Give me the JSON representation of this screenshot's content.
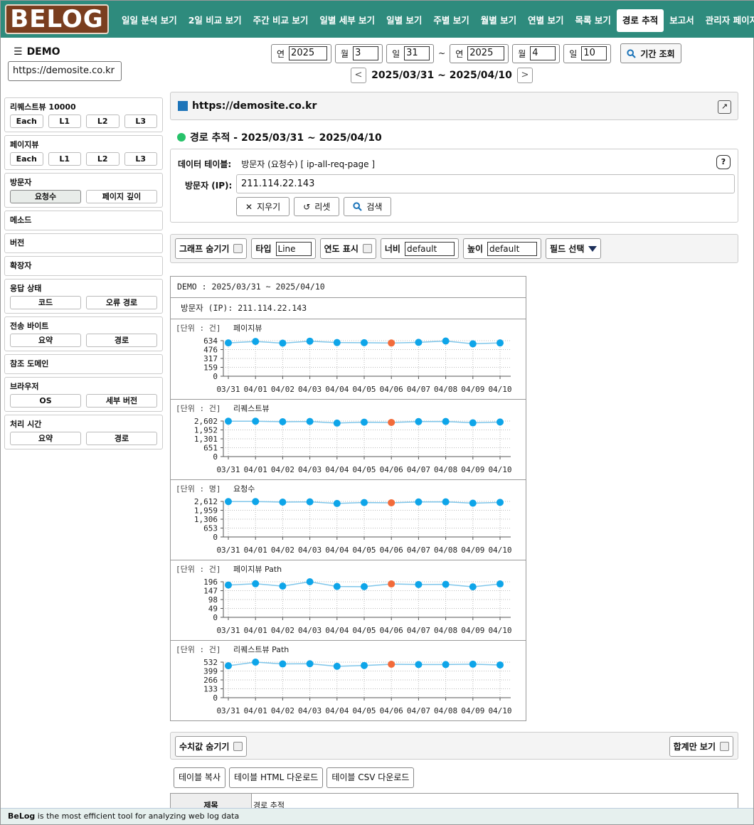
{
  "app": {
    "logo": "BELOG",
    "nav": [
      "일일 분석 보기",
      "2일 비교 보기",
      "주간 비교 보기",
      "일별 세부 보기",
      "일별 보기",
      "주별 보기",
      "월별 보기",
      "연별 보기",
      "목록 보기",
      "경로 추적",
      "보고서",
      "관리자 페이지"
    ],
    "nav_active": "경로 추적"
  },
  "site": {
    "name": "DEMO",
    "url": "https://demosite.co.kr"
  },
  "date_filter": {
    "from_year_label": "연",
    "from_year": "2025",
    "from_month_label": "월",
    "from_month": "3",
    "from_day_label": "일",
    "from_day": "31",
    "sep": "~",
    "to_year_label": "연",
    "to_year": "2025",
    "to_month_label": "월",
    "to_month": "4",
    "to_day_label": "일",
    "to_day": "10",
    "query_label": "기간 조회",
    "range_text": "2025/03/31 ~ 2025/04/10",
    "prev": "<",
    "next": ">"
  },
  "sidebar": [
    {
      "title": "리퀘스트뷰 10000",
      "buttons": [
        "Each",
        "L1",
        "L2",
        "L3"
      ]
    },
    {
      "title": "페이지뷰",
      "buttons": [
        "Each",
        "L1",
        "L2",
        "L3"
      ]
    },
    {
      "title": "방문자",
      "buttons": [
        "요청수",
        "페이지 깊이"
      ],
      "active": "요청수"
    },
    {
      "title": "메소드",
      "buttons": []
    },
    {
      "title": "버전",
      "buttons": []
    },
    {
      "title": "확장자",
      "buttons": []
    },
    {
      "title": "응답 상태",
      "buttons": [
        "코드",
        "오류 경로"
      ]
    },
    {
      "title": "전송 바이트",
      "buttons": [
        "요약",
        "경로"
      ]
    },
    {
      "title": "참조 도메인",
      "buttons": []
    },
    {
      "title": "브라우저",
      "buttons": [
        "OS",
        "세부 버전"
      ]
    },
    {
      "title": "처리 시간",
      "buttons": [
        "요약",
        "경로"
      ]
    }
  ],
  "main": {
    "header_url": "https://demosite.co.kr",
    "section_title": "경로 추적 - 2025/03/31 ~ 2025/04/10",
    "data_table_label": "데이터 테이블:",
    "data_table_value": "방문자 (요청수)  [ ip-all-req-page ]",
    "help": "?",
    "visitor_label": "방문자 (IP):",
    "visitor_value": "211.114.22.143",
    "btn_clear": "지우기",
    "btn_reset": "리셋",
    "btn_search": "검색"
  },
  "toolbar": {
    "hide_graph": "그래프 숨기기",
    "type_label": "타입",
    "type_value": "Line",
    "year_show": "연도 표시",
    "width_label": "너비",
    "width_value": "default",
    "height_label": "높이",
    "height_value": "default",
    "field_select": "필드 선택"
  },
  "chart_panel": {
    "line1": "DEMO : 2025/03/31 ~ 2025/04/10",
    "line2": "방문자 (IP): 211.114.22.143"
  },
  "chart_data": [
    {
      "type": "line",
      "title": "페이지뷰",
      "unit_label": "[단위 : 건]",
      "x": [
        "03/31",
        "04/01",
        "04/02",
        "04/03",
        "04/04",
        "04/05",
        "04/06",
        "04/07",
        "04/08",
        "04/09",
        "04/10"
      ],
      "yticks": [
        "0",
        "159",
        "317",
        "476",
        "634"
      ],
      "ylim": [
        0,
        634
      ],
      "values": [
        595,
        620,
        590,
        625,
        600,
        598,
        592,
        604,
        628,
        578,
        594
      ],
      "highlight_index": 6,
      "colors": {
        "line": "#7fc6ea",
        "point": "#0ea5e9",
        "highlight": "#f26b3a"
      }
    },
    {
      "type": "line",
      "title": "리퀘스트뷰",
      "unit_label": "[단위 : 건]",
      "x": [
        "03/31",
        "04/01",
        "04/02",
        "04/03",
        "04/04",
        "04/05",
        "04/06",
        "04/07",
        "04/08",
        "04/09",
        "04/10"
      ],
      "yticks": [
        "0",
        "651",
        "1,301",
        "1,952",
        "2,602"
      ],
      "ylim": [
        0,
        2602
      ],
      "values": [
        2590,
        2590,
        2550,
        2570,
        2450,
        2520,
        2500,
        2560,
        2570,
        2470,
        2530
      ],
      "highlight_index": 6,
      "colors": {
        "line": "#7fc6ea",
        "point": "#0ea5e9",
        "highlight": "#f26b3a"
      }
    },
    {
      "type": "line",
      "title": "요청수",
      "unit_label": "[단위 : 명]",
      "x": [
        "03/31",
        "04/01",
        "04/02",
        "04/03",
        "04/04",
        "04/05",
        "04/06",
        "04/07",
        "04/08",
        "04/09",
        "04/10"
      ],
      "yticks": [
        "0",
        "653",
        "1,306",
        "1,959",
        "2,612"
      ],
      "ylim": [
        0,
        2612
      ],
      "values": [
        2600,
        2600,
        2560,
        2580,
        2460,
        2530,
        2510,
        2570,
        2580,
        2480,
        2540
      ],
      "highlight_index": 6,
      "colors": {
        "line": "#7fc6ea",
        "point": "#0ea5e9",
        "highlight": "#f26b3a"
      }
    },
    {
      "type": "line",
      "title": "페이지뷰 Path",
      "unit_label": "[단위 : 건]",
      "x": [
        "03/31",
        "04/01",
        "04/02",
        "04/03",
        "04/04",
        "04/05",
        "04/06",
        "04/07",
        "04/08",
        "04/09",
        "04/10"
      ],
      "yticks": [
        "0",
        "49",
        "98",
        "147",
        "196"
      ],
      "ylim": [
        0,
        196
      ],
      "values": [
        178,
        185,
        172,
        196,
        170,
        169,
        184,
        181,
        182,
        168,
        184
      ],
      "highlight_index": 6,
      "colors": {
        "line": "#7fc6ea",
        "point": "#0ea5e9",
        "highlight": "#f26b3a"
      }
    },
    {
      "type": "line",
      "title": "리퀘스트뷰 Path",
      "unit_label": "[단위 : 건]",
      "x": [
        "03/31",
        "04/01",
        "04/02",
        "04/03",
        "04/04",
        "04/05",
        "04/06",
        "04/07",
        "04/08",
        "04/09",
        "04/10"
      ],
      "yticks": [
        "0",
        "133",
        "266",
        "399",
        "532"
      ],
      "ylim": [
        0,
        532
      ],
      "values": [
        478,
        532,
        505,
        508,
        470,
        482,
        500,
        496,
        496,
        502,
        490
      ],
      "highlight_index": 6,
      "colors": {
        "line": "#7fc6ea",
        "point": "#0ea5e9",
        "highlight": "#f26b3a"
      }
    }
  ],
  "bottom": {
    "hide_values": "수치값 숨기기",
    "sum_only": "합계만 보기",
    "copy_table": "테이블 복사",
    "html_download": "테이블 HTML 다운로드",
    "csv_download": "테이블 CSV 다운로드",
    "table_header": "제목",
    "table_value": "경로 추적"
  },
  "footer": {
    "brand": "BeLog",
    "text": " is the most efficient tool for analyzing web log data"
  }
}
